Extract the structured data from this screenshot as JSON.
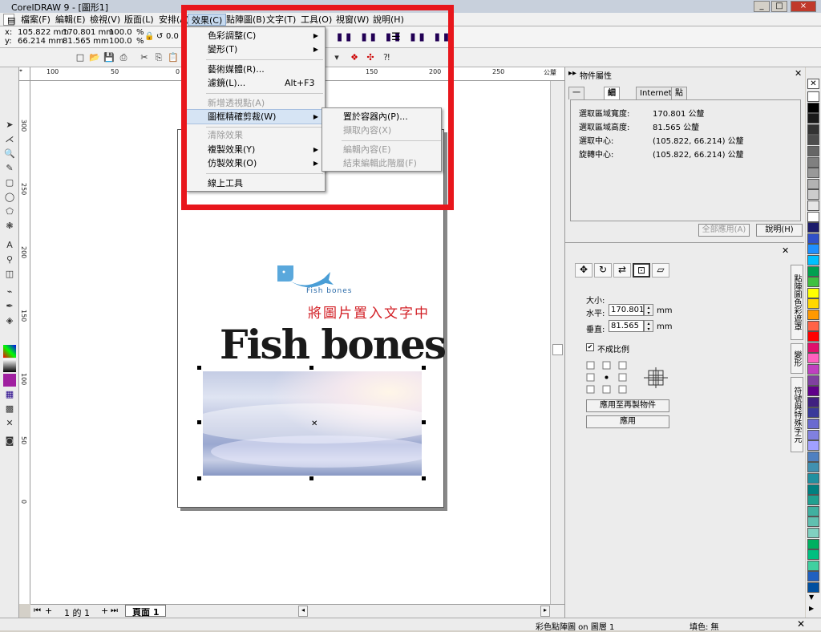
{
  "window": {
    "title": "CorelDRAW 9 - [圖形1]",
    "min": "_",
    "max": "□",
    "close": "×"
  },
  "menubar": [
    "檔案(F)",
    "編輯(E)",
    "檢視(V)",
    "版面(L)",
    "安排(A)",
    "效果(C)",
    "點陣圖(B)",
    "文字(T)",
    "工具(O)",
    "視窗(W)",
    "說明(H)"
  ],
  "propbar": {
    "x": "105.822 mm",
    "y": "66.214 mm",
    "w": "170.801 mm",
    "h": "81.565 mm",
    "scale_x": "100.0",
    "scale_y": "100.0",
    "pct": "%",
    "rotation": "0.0"
  },
  "effects_menu": {
    "items": [
      {
        "label": "色彩調整(C)",
        "sub": true,
        "disabled": false
      },
      {
        "label": "變形(T)",
        "sub": true,
        "disabled": false
      },
      {
        "label": "藝術媒體(R)...",
        "sub": false,
        "disabled": false
      },
      {
        "label": "濾鏡(L)...",
        "shortcut": "Alt+F3",
        "disabled": false
      },
      {
        "label": "新增透視點(A)",
        "disabled": true
      },
      {
        "label": "圖框精確剪裁(W)",
        "sub": true,
        "highlighted": true
      },
      {
        "label": "清除效果",
        "disabled": true
      },
      {
        "label": "複製效果(Y)",
        "sub": true
      },
      {
        "label": "仿製效果(O)",
        "sub": true
      },
      {
        "label": "線上工具"
      }
    ]
  },
  "powerclip_submenu": [
    "置於容器內(P)...",
    "擷取內容(X)",
    "編輯內容(E)",
    "結束編輯此階層(F)"
  ],
  "canvas": {
    "logo_text": "Fish bones",
    "red_caption": "將圖片置入文字中",
    "big_text": "Fish bones",
    "hruler_ticks": [
      "100",
      "50",
      "0",
      "50",
      "100",
      "150",
      "200",
      "250"
    ],
    "hruler_unit": "公釐",
    "vruler_ticks": [
      "300",
      "250",
      "200",
      "150",
      "100",
      "50",
      "0"
    ]
  },
  "page_nav": {
    "page_of": "1 的 1",
    "page_tab": "頁面 1"
  },
  "status": {
    "left": "彩色點陣圖 on 圖層 1",
    "fill": "填色: 無"
  },
  "object_props": {
    "title": "物件屬性",
    "tabs": [
      "一般",
      "細節",
      "Internet",
      "點陣圖"
    ],
    "rows": [
      {
        "k": "選取區域寬度:",
        "v": "170.801 公釐"
      },
      {
        "k": "選取區域高度:",
        "v": "81.565 公釐"
      },
      {
        "k": "選取中心:",
        "v": "(105.822, 66.214) 公釐"
      },
      {
        "k": "旋轉中心:",
        "v": "(105.822, 66.214) 公釐"
      }
    ],
    "apply_all": "全部應用(A)",
    "help": "說明(H)"
  },
  "transform": {
    "size_label": "大小:",
    "h_label": "水平:",
    "h_value": "170.801",
    "unit": "mm",
    "v_label": "垂直:",
    "v_value": "81.565",
    "nonprop": "不成比例",
    "apply_dup": "應用至再製物件",
    "apply": "應用"
  },
  "side_tabs": [
    "點陣圖色彩遮罩",
    "變形",
    "符號與特殊字元"
  ],
  "palette_colors": [
    "#ffffff",
    "#000000",
    "#1a1a1a",
    "#333333",
    "#4d4d4d",
    "#666666",
    "#808080",
    "#999999",
    "#b3b3b3",
    "#cccccc",
    "#e6e6e6",
    "#ffffff",
    "#1c1c6b",
    "#3050c8",
    "#1e90ff",
    "#00c0ff",
    "#00a050",
    "#40c040",
    "#ffff00",
    "#ffd700",
    "#ff9900",
    "#ff6347",
    "#ff0000",
    "#e0106c",
    "#ff60c0",
    "#c040c0",
    "#8040a0",
    "#60008a",
    "#402080",
    "#3a3a9a",
    "#6a6ad0",
    "#8080e0",
    "#a0a0ff",
    "#5080c0",
    "#4090b0",
    "#2090a0",
    "#008080",
    "#20a090",
    "#40b0a0",
    "#60c0b0",
    "#80d0c0",
    "#00b060",
    "#00c080",
    "#40d0a0",
    "#2060c0",
    "#0050a0"
  ]
}
